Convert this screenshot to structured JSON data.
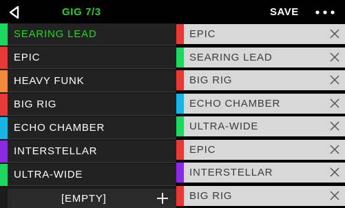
{
  "header": {
    "title": "GIG 7/3",
    "save_label": "SAVE",
    "back_icon": "back-arrow-icon",
    "more_icon": "more-options-icon"
  },
  "colors": {
    "accent_green": "#29d12a",
    "bar_green": "#1ed760",
    "bar_red": "#e53935",
    "bar_orange": "#f28a3c",
    "bar_cyan": "#18b4e4",
    "bar_purple": "#8a2be2",
    "bar_blue": "#3aa0d8"
  },
  "setlist": [
    {
      "label": "SEARING LEAD",
      "color": "#1ed760",
      "active": true
    },
    {
      "label": "EPIC",
      "color": "#e53935",
      "active": false
    },
    {
      "label": "HEAVY FUNK",
      "color": "#f28a3c",
      "active": false
    },
    {
      "label": "BIG RIG",
      "color": "#e53935",
      "active": false
    },
    {
      "label": "ECHO CHAMBER",
      "color": "#18b4e4",
      "active": false
    },
    {
      "label": "INTERSTELLAR",
      "color": "#8a2be2",
      "active": false
    },
    {
      "label": "ULTRA-WIDE",
      "color": "#1ed760",
      "active": false
    }
  ],
  "empty_slot": {
    "label": "[EMPTY]",
    "add_icon": "plus-icon"
  },
  "queue": [
    {
      "label": "EPIC",
      "color": "#e53935"
    },
    {
      "label": "SEARING LEAD",
      "color": "#1ed760"
    },
    {
      "label": "BIG RIG",
      "color": "#e53935"
    },
    {
      "label": "ECHO CHAMBER",
      "color": "#18b4e4"
    },
    {
      "label": "ULTRA-WIDE",
      "color": "#1ed760"
    },
    {
      "label": "EPIC",
      "color": "#e53935"
    },
    {
      "label": "INTERSTELLAR",
      "color": "#8a2be2"
    },
    {
      "label": "BIG RIG",
      "color": "#e53935"
    }
  ]
}
